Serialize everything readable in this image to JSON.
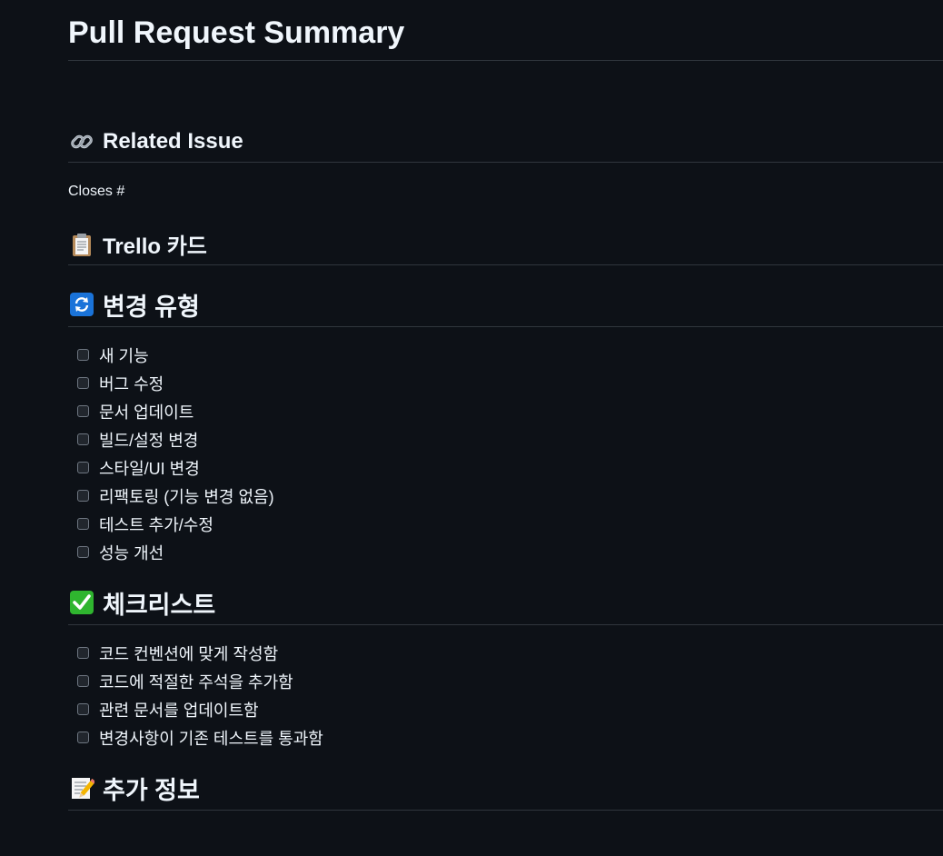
{
  "title": "Pull Request Summary",
  "related_issue": {
    "heading": "Related Issue",
    "icon": "link-icon",
    "text": "Closes #"
  },
  "trello": {
    "heading": "Trello 카드",
    "icon": "clipboard-icon"
  },
  "change_type": {
    "heading": "변경 유형",
    "icon": "arrows-counterclockwise-icon",
    "items": [
      "새 기능",
      "버그 수정",
      "문서 업데이트",
      "빌드/설정 변경",
      "스타일/UI 변경",
      "리팩토링 (기능 변경 없음)",
      "테스트 추가/수정",
      "성능 개선"
    ]
  },
  "checklist": {
    "heading": "체크리스트",
    "icon": "check-mark-button-icon",
    "items": [
      "코드 컨벤션에 맞게 작성함",
      "코드에 적절한 주석을 추가함",
      "관련 문서를 업데이트함",
      "변경사항이 기존 테스트를 통과함"
    ]
  },
  "additional": {
    "heading": "추가 정보",
    "icon": "memo-icon"
  },
  "colors": {
    "background": "#0d1117",
    "text": "#f0f6fc",
    "divider": "#30363d",
    "checkbox_border": "#6e7681",
    "checkbox_fill": "#21262d"
  }
}
